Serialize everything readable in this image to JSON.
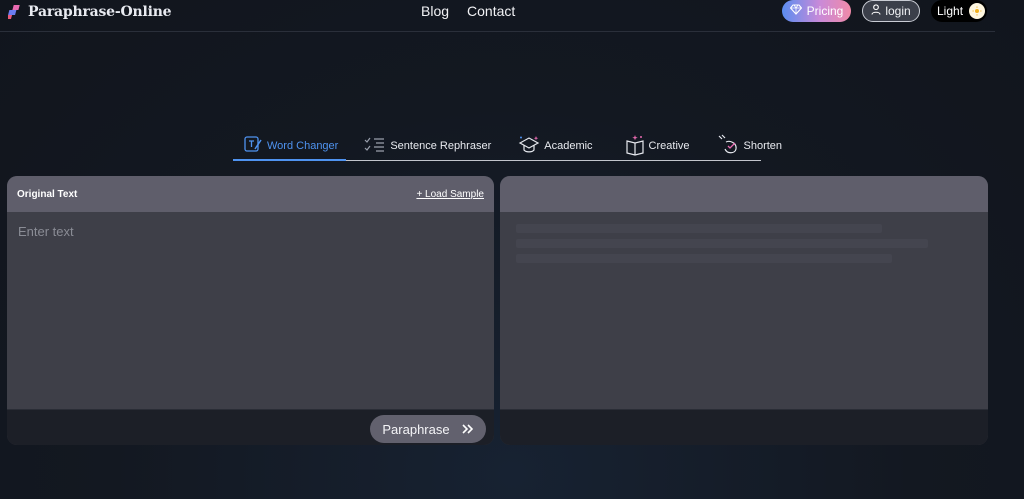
{
  "header": {
    "logo_text": "Paraphrase-Online",
    "nav": [
      "Blog",
      "Contact"
    ],
    "pricing_label": "Pricing",
    "login_label": "login",
    "theme_label": "Light"
  },
  "tabs": [
    {
      "label": "Word Changer",
      "icon": "word-changer-icon",
      "active": true
    },
    {
      "label": "Sentence Rephraser",
      "icon": "list-check-icon",
      "active": false
    },
    {
      "label": "Academic",
      "icon": "graduation-cap-icon",
      "active": false
    },
    {
      "label": "Creative",
      "icon": "book-sparkle-icon",
      "active": false
    },
    {
      "label": "Shorten",
      "icon": "shorten-icon",
      "active": false
    }
  ],
  "input_panel": {
    "title": "Original Text",
    "load_sample_label": "+ Load Sample",
    "placeholder": "Enter text"
  },
  "actions": {
    "paraphrase_label": "Paraphrase"
  },
  "colors": {
    "accent": "#4f93f0",
    "panel_header": "#5f5e6b",
    "panel_body": "#3e3f48",
    "page_bg": "#12161f"
  }
}
